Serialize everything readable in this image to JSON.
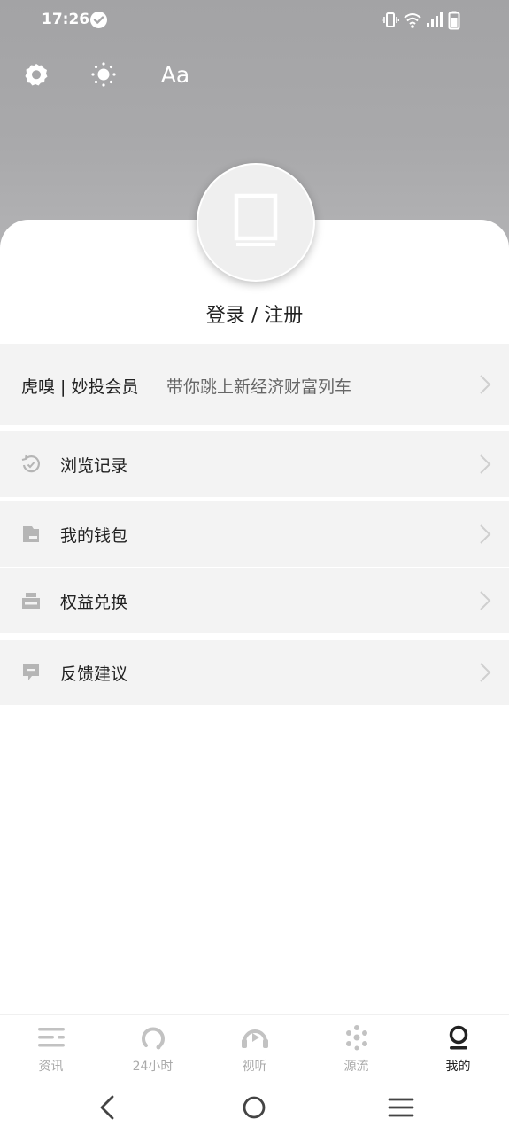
{
  "status_bar": {
    "time": "17:26",
    "icons": [
      "check-circle-icon",
      "vibrate-icon",
      "wifi-icon",
      "signal-icon",
      "battery-icon"
    ]
  },
  "toolbar": {
    "settings_icon": "gear-icon",
    "brightness_icon": "sun-icon",
    "font_size_label": "Aa"
  },
  "profile": {
    "avatar_icon": "book-placeholder-icon",
    "login_label": "登录 / 注册"
  },
  "vip": {
    "title": "虎嗅 | 妙投会员",
    "subtitle": "带你跳上新经济财富列车"
  },
  "menu": [
    {
      "label": "浏览记录",
      "icon": "history-icon"
    },
    {
      "label": "我的钱包",
      "icon": "wallet-icon"
    },
    {
      "label": "权益兑换",
      "icon": "exchange-icon"
    },
    {
      "label": "反馈建议",
      "icon": "feedback-icon"
    }
  ],
  "bottom_nav": [
    {
      "label": "资讯",
      "icon": "news-icon",
      "active": false
    },
    {
      "label": "24小时",
      "icon": "clock-24-icon",
      "active": false
    },
    {
      "label": "视听",
      "icon": "video-play-icon",
      "active": false
    },
    {
      "label": "源流",
      "icon": "source-icon",
      "active": false
    },
    {
      "label": "我的",
      "icon": "profile-icon",
      "active": true
    }
  ],
  "colors": {
    "header_bg": "#a9a9ab",
    "row_bg": "#f3f3f3",
    "inactive_nav": "#aaaaaa",
    "active_nav": "#222222"
  }
}
